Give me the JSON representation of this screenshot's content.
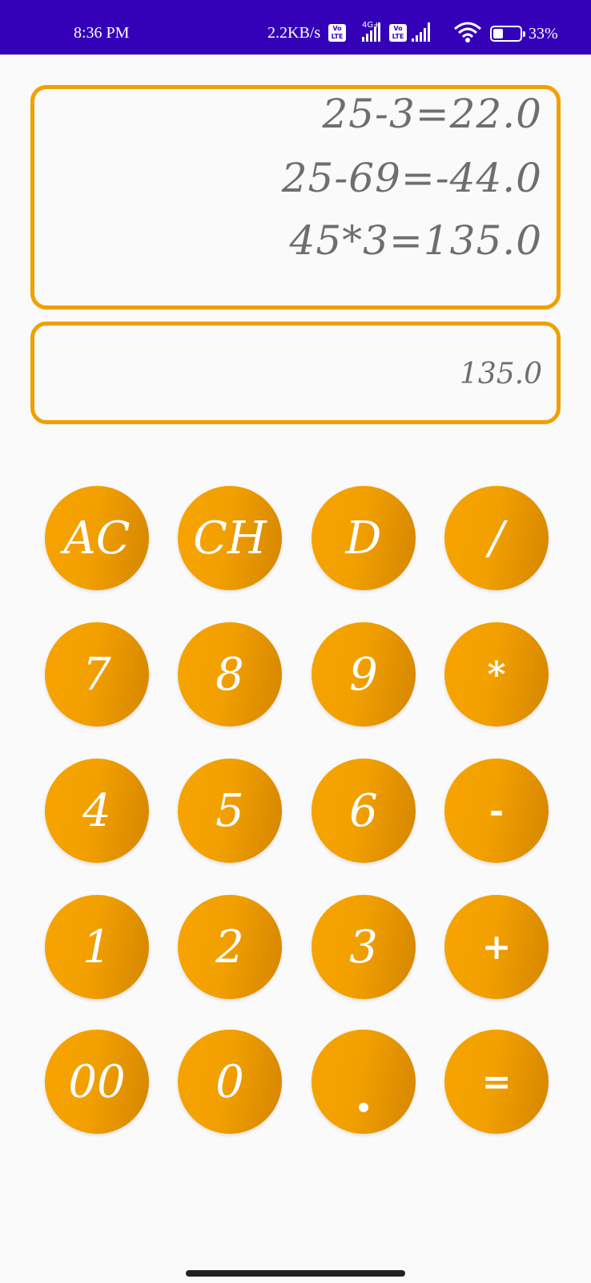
{
  "status_bar": {
    "time": "8:36 PM",
    "speed": "2.2KB/s",
    "network_type": "4G+",
    "volte_badge": "Vo LTE",
    "battery": "33%",
    "battery_level": 0.33
  },
  "display": {
    "history": [
      "25-3=22.0",
      "25-69=-44.0",
      "45*3=135.0"
    ],
    "result": "135.0"
  },
  "keypad": {
    "ac": "AC",
    "ch": "CH",
    "d": "D",
    "divide": "/",
    "k7": "7",
    "k8": "8",
    "k9": "9",
    "multiply": "*",
    "k4": "4",
    "k5": "5",
    "k6": "6",
    "minus": "-",
    "k1": "1",
    "k2": "2",
    "k3": "3",
    "plus": "+",
    "k00": "00",
    "k0": "0",
    "dot": ".",
    "equals": "="
  },
  "colors": {
    "accent": "#f2a000",
    "status_bar": "#3400b8",
    "text_gray": "#6e6e6e",
    "background": "#fafafa"
  }
}
